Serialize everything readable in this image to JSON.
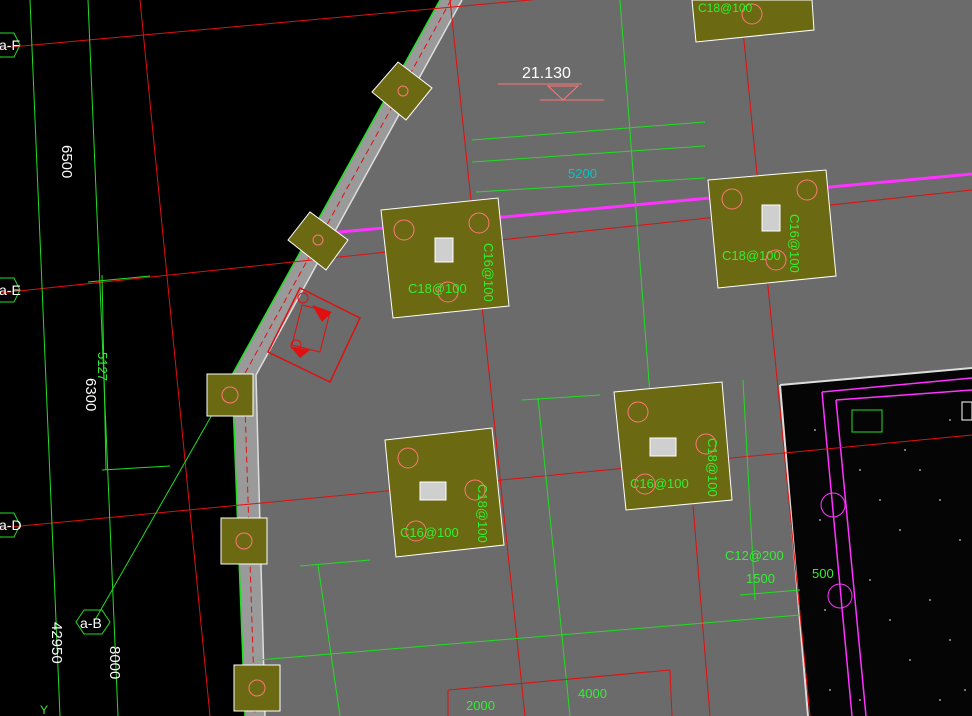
{
  "colors": {
    "background": "#000000",
    "slab": "#6b6b6b",
    "pile_cap": "#6b6a12",
    "gridline": "#e01010",
    "dimension": "#22dd22",
    "rebar_pink": "#ff33ff",
    "text_white": "#ffffff",
    "text_cyan": "#00c8c8"
  },
  "axes": {
    "a_f": "a-F",
    "a_e": "a-E",
    "a_d": "a-D",
    "a_b": "a-B"
  },
  "dimensions": {
    "d6500": "6500",
    "d6300": "6300",
    "d5127": "5127",
    "d42950": "42950",
    "d8000": "8000",
    "d5200": "5200",
    "d1500": "1500",
    "d500": "500",
    "d2000": "2000",
    "d4000": "4000"
  },
  "elevation": {
    "value": "21.130"
  },
  "rebar_labels": {
    "cap_top": "C18@100",
    "cap1_h": "C18@100",
    "cap1_v": "C16@100",
    "cap2_h": "C18@100",
    "cap2_v": "C16@100",
    "cap3_h": "C16@100",
    "cap3_v": "C18@100",
    "cap4_h": "C16@100",
    "cap4_v": "C18@100",
    "beam_c12": "C12@200"
  },
  "corner_label": "Y"
}
